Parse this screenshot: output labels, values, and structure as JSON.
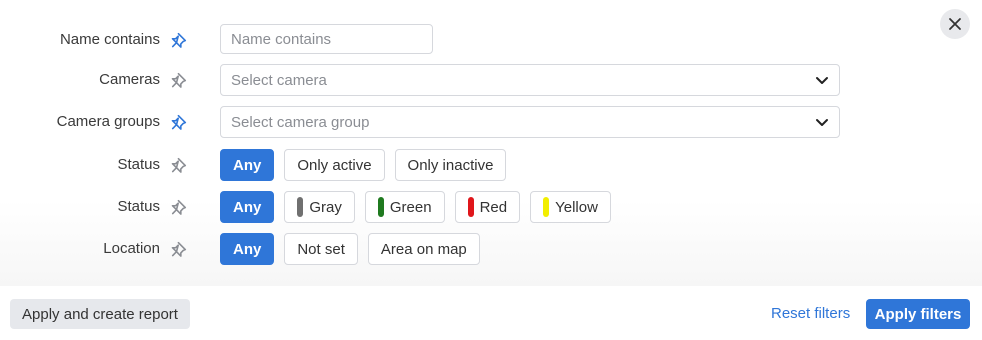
{
  "close": {
    "icon": "close-icon"
  },
  "filters": {
    "name_contains": {
      "label": "Name contains",
      "pinned": true,
      "placeholder": "Name contains",
      "value": ""
    },
    "cameras": {
      "label": "Cameras",
      "pinned": false,
      "placeholder": "Select camera"
    },
    "camera_groups": {
      "label": "Camera groups",
      "pinned": true,
      "placeholder": "Select camera group"
    },
    "status_active": {
      "label": "Status",
      "pinned": false,
      "options": [
        "Any",
        "Only active",
        "Only inactive"
      ],
      "selected": "Any"
    },
    "status_color": {
      "label": "Status",
      "pinned": false,
      "options": [
        {
          "label": "Any",
          "color": null
        },
        {
          "label": "Gray",
          "color": "#707070"
        },
        {
          "label": "Green",
          "color": "#1f7a1f"
        },
        {
          "label": "Red",
          "color": "#e0161b"
        },
        {
          "label": "Yellow",
          "color": "#f2ee00"
        }
      ],
      "selected": "Any"
    },
    "location": {
      "label": "Location",
      "pinned": false,
      "options": [
        "Any",
        "Not set",
        "Area on map"
      ],
      "selected": "Any"
    }
  },
  "footer": {
    "apply_create_label": "Apply and create report",
    "reset_label": "Reset filters",
    "apply_label": "Apply filters"
  },
  "colors": {
    "accent": "#2f76d8",
    "pin_active": "#2f76d8",
    "pin_inactive": "#8a8d93"
  }
}
